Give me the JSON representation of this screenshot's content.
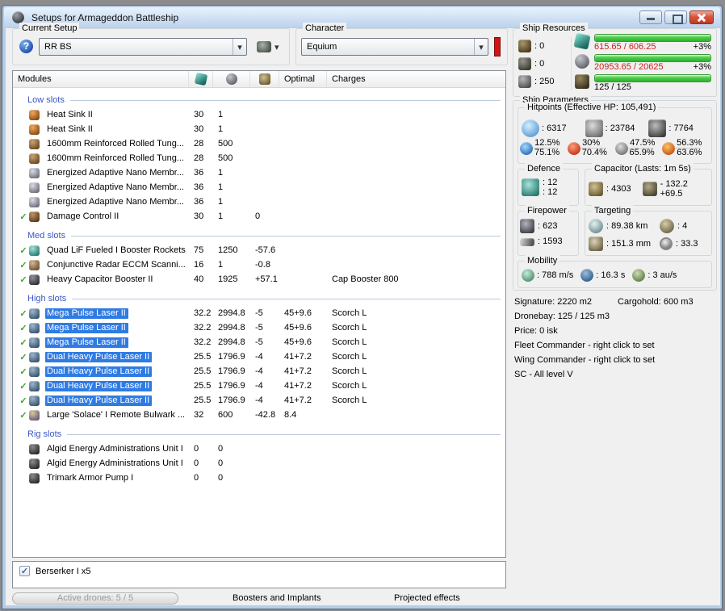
{
  "window": {
    "title": "Setups for Armageddon Battleship"
  },
  "setup": {
    "label": "Current Setup",
    "value": "RR BS"
  },
  "character": {
    "label": "Character",
    "value": "Equium"
  },
  "modules": {
    "columns": {
      "modules": "Modules",
      "optimal": "Optimal",
      "charges": "Charges"
    },
    "sections": [
      {
        "label": "Low slots",
        "rows": [
          {
            "active": false,
            "selected": false,
            "icon": "heat-sink-icon",
            "name": "Heat Sink II",
            "cpu": "30",
            "pg": "1",
            "cap": "",
            "optimal": "",
            "charges": ""
          },
          {
            "active": false,
            "selected": false,
            "icon": "heat-sink-icon",
            "name": "Heat Sink II",
            "cpu": "30",
            "pg": "1",
            "cap": "",
            "optimal": "",
            "charges": ""
          },
          {
            "active": false,
            "selected": false,
            "icon": "armor-plate-icon",
            "name": "1600mm Reinforced Rolled Tung...",
            "cpu": "28",
            "pg": "500",
            "cap": "",
            "optimal": "",
            "charges": ""
          },
          {
            "active": false,
            "selected": false,
            "icon": "armor-plate-icon",
            "name": "1600mm Reinforced Rolled Tung...",
            "cpu": "28",
            "pg": "500",
            "cap": "",
            "optimal": "",
            "charges": ""
          },
          {
            "active": false,
            "selected": false,
            "icon": "membrane-icon",
            "name": "Energized Adaptive Nano Membr...",
            "cpu": "36",
            "pg": "1",
            "cap": "",
            "optimal": "",
            "charges": ""
          },
          {
            "active": false,
            "selected": false,
            "icon": "membrane-icon",
            "name": "Energized Adaptive Nano Membr...",
            "cpu": "36",
            "pg": "1",
            "cap": "",
            "optimal": "",
            "charges": ""
          },
          {
            "active": false,
            "selected": false,
            "icon": "membrane-icon",
            "name": "Energized Adaptive Nano Membr...",
            "cpu": "36",
            "pg": "1",
            "cap": "",
            "optimal": "",
            "charges": ""
          },
          {
            "active": true,
            "selected": false,
            "icon": "damage-control-icon",
            "name": "Damage Control II",
            "cpu": "30",
            "pg": "1",
            "cap": "0",
            "optimal": "",
            "charges": ""
          }
        ]
      },
      {
        "label": "Med slots",
        "rows": [
          {
            "active": true,
            "selected": false,
            "icon": "booster-rockets-icon",
            "name": "Quad LiF Fueled I Booster Rockets",
            "cpu": "75",
            "pg": "1250",
            "cap": "-57.6",
            "optimal": "",
            "charges": ""
          },
          {
            "active": true,
            "selected": false,
            "icon": "eccm-icon",
            "name": "Conjunctive Radar ECCM Scanni...",
            "cpu": "16",
            "pg": "1",
            "cap": "-0.8",
            "optimal": "",
            "charges": ""
          },
          {
            "active": true,
            "selected": false,
            "icon": "cap-booster-icon",
            "name": "Heavy Capacitor Booster II",
            "cpu": "40",
            "pg": "1925",
            "cap": "+57.1",
            "optimal": "",
            "charges": "Cap Booster 800"
          }
        ]
      },
      {
        "label": "High slots",
        "rows": [
          {
            "active": true,
            "selected": true,
            "icon": "pulse-laser-icon",
            "name": "Mega Pulse Laser II",
            "cpu": "32.2",
            "pg": "2994.8",
            "cap": "-5",
            "optimal": "45+9.6",
            "charges": "Scorch L"
          },
          {
            "active": true,
            "selected": true,
            "icon": "pulse-laser-icon",
            "name": "Mega Pulse Laser II",
            "cpu": "32.2",
            "pg": "2994.8",
            "cap": "-5",
            "optimal": "45+9.6",
            "charges": "Scorch L"
          },
          {
            "active": true,
            "selected": true,
            "icon": "pulse-laser-icon",
            "name": "Mega Pulse Laser II",
            "cpu": "32.2",
            "pg": "2994.8",
            "cap": "-5",
            "optimal": "45+9.6",
            "charges": "Scorch L"
          },
          {
            "active": true,
            "selected": true,
            "icon": "pulse-laser-icon",
            "name": "Dual Heavy Pulse Laser II",
            "cpu": "25.5",
            "pg": "1796.9",
            "cap": "-4",
            "optimal": "41+7.2",
            "charges": "Scorch L"
          },
          {
            "active": true,
            "selected": true,
            "icon": "pulse-laser-icon",
            "name": "Dual Heavy Pulse Laser II",
            "cpu": "25.5",
            "pg": "1796.9",
            "cap": "-4",
            "optimal": "41+7.2",
            "charges": "Scorch L"
          },
          {
            "active": true,
            "selected": true,
            "icon": "pulse-laser-icon",
            "name": "Dual Heavy Pulse Laser II",
            "cpu": "25.5",
            "pg": "1796.9",
            "cap": "-4",
            "optimal": "41+7.2",
            "charges": "Scorch L"
          },
          {
            "active": true,
            "selected": true,
            "icon": "pulse-laser-icon",
            "name": "Dual Heavy Pulse Laser II",
            "cpu": "25.5",
            "pg": "1796.9",
            "cap": "-4",
            "optimal": "41+7.2",
            "charges": "Scorch L"
          },
          {
            "active": true,
            "selected": false,
            "icon": "remote-rep-icon",
            "name": "Large 'Solace' I Remote Bulwark ...",
            "cpu": "32",
            "pg": "600",
            "cap": "-42.8",
            "optimal": "8.4",
            "charges": ""
          }
        ]
      },
      {
        "label": "Rig slots",
        "rows": [
          {
            "active": false,
            "selected": false,
            "icon": "rig-icon",
            "name": "Algid Energy Administrations Unit I",
            "cpu": "0",
            "pg": "0",
            "cap": "",
            "optimal": "",
            "charges": ""
          },
          {
            "active": false,
            "selected": false,
            "icon": "rig-icon",
            "name": "Algid Energy Administrations Unit I",
            "cpu": "0",
            "pg": "0",
            "cap": "",
            "optimal": "",
            "charges": ""
          },
          {
            "active": false,
            "selected": false,
            "icon": "rig-icon",
            "name": "Trimark Armor Pump I",
            "cpu": "0",
            "pg": "0",
            "cap": "",
            "optimal": "",
            "charges": ""
          }
        ]
      }
    ]
  },
  "resources": {
    "label": "Ship Resources",
    "turrets": ": 0",
    "launchers": ": 0",
    "calibration": ": 250",
    "cpu_text": "615.65 / 606.25",
    "cpu_suffix": "+3%",
    "pg_text": "20953.65 / 20625",
    "pg_suffix": "+3%",
    "drone_text": "125 / 125"
  },
  "parameters": {
    "label": "Ship Parameters",
    "hitpoints": {
      "label": "Hitpoints (Effective HP: 105,491)",
      "shield": ": 6317",
      "armor": ": 23784",
      "structure": ": 7764",
      "resists": [
        {
          "top": "12.5%",
          "bottom": "75.1%"
        },
        {
          "top": "30%",
          "bottom": "70.4%"
        },
        {
          "top": "47.5%",
          "bottom": "65.9%"
        },
        {
          "top": "56.3%",
          "bottom": "63.6%"
        }
      ]
    },
    "defence": {
      "label": "Defence",
      "top": ": 12",
      "bottom": ": 12"
    },
    "capacitor": {
      "label": "Capacitor (Lasts: 1m 5s)",
      "amount": ": 4303",
      "delta_top": "- 132.2",
      "delta_bottom": "+69.5"
    },
    "firepower": {
      "label": "Firepower",
      "turret": ": 623",
      "missile": ": 1593"
    },
    "targeting": {
      "label": "Targeting",
      "range": ": 89.38 km",
      "max_targets": ": 4",
      "scan_res": ": 151.3 mm",
      "sensor": ": 33.3"
    },
    "mobility": {
      "label": "Mobility",
      "speed": ": 788 m/s",
      "align": ": 16.3 s",
      "warp": ": 3 au/s"
    }
  },
  "info": {
    "signature": "Signature: 2220 m2",
    "cargohold": "Cargohold: 600 m3",
    "lines": [
      "Dronebay: 125 / 125 m3",
      "Price: 0 isk",
      "Fleet Commander - right click to set",
      "Wing Commander - right click to set",
      "SC - All level V"
    ]
  },
  "drones": {
    "checked": true,
    "label": "Berserker I x5"
  },
  "bottom": {
    "active_drones": "Active drones: 5 / 5",
    "boosters": "Boosters and Implants",
    "projected": "Projected effects"
  }
}
